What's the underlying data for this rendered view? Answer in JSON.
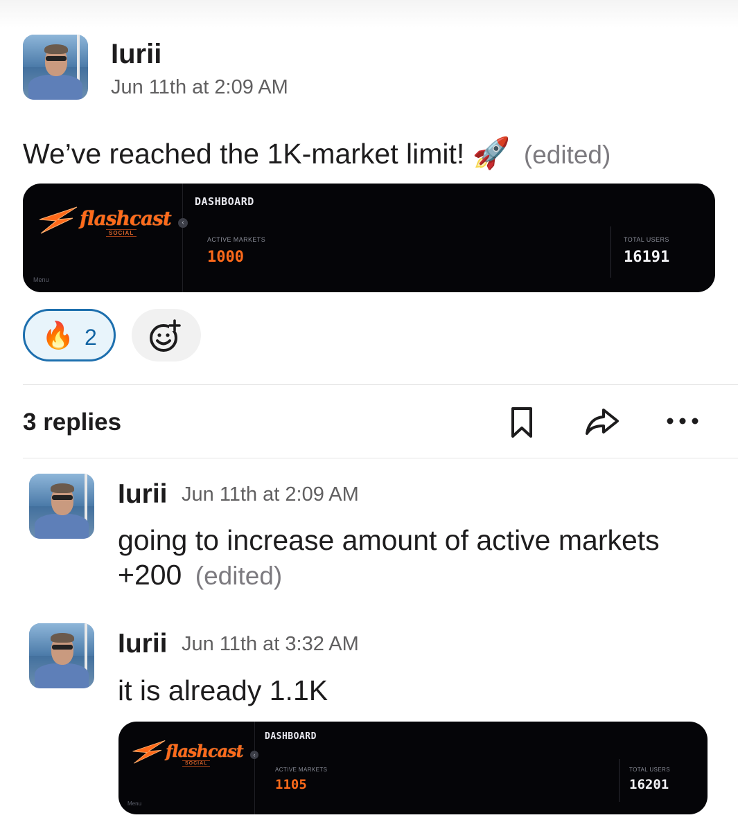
{
  "post": {
    "author": "Iurii",
    "timestamp": "Jun 11th at 2:09 AM",
    "text": "We’ve reached the 1K-market limit!",
    "emoji": "🚀",
    "edited": "(edited)",
    "dashboard": {
      "logo": "flashcast",
      "logo_sub": "SOCIAL",
      "menu": "Menu",
      "title": "DASHBOARD",
      "active_markets_label": "ACTIVE MARKETS",
      "active_markets_value": "1000",
      "total_users_label": "TOTAL USERS",
      "total_users_value": "16191"
    },
    "reaction": {
      "emoji": "🔥",
      "count": "2"
    }
  },
  "thread": {
    "replies_label": "3 replies",
    "actions": [
      "bookmark-icon",
      "share-icon",
      "more-icon"
    ]
  },
  "replies": [
    {
      "author": "Iurii",
      "timestamp": "Jun 11th at 2:09 AM",
      "text_line1": "going to increase amount of active markets",
      "text_line2": "+200",
      "edited": "(edited)"
    },
    {
      "author": "Iurii",
      "timestamp": "Jun 11th at 3:32 AM",
      "text": "it is already 1.1K",
      "dashboard": {
        "logo": "flashcast",
        "logo_sub": "SOCIAL",
        "menu": "Menu",
        "title": "DASHBOARD",
        "active_markets_label": "ACTIVE MARKETS",
        "active_markets_value": "1105",
        "total_users_label": "TOTAL USERS",
        "total_users_value": "16201"
      }
    }
  ],
  "colors": {
    "accent_orange": "#ff6a1a",
    "reaction_border": "#1d6fae",
    "reaction_bg": "#e8f4fb",
    "dashboard_bg": "#050508"
  }
}
